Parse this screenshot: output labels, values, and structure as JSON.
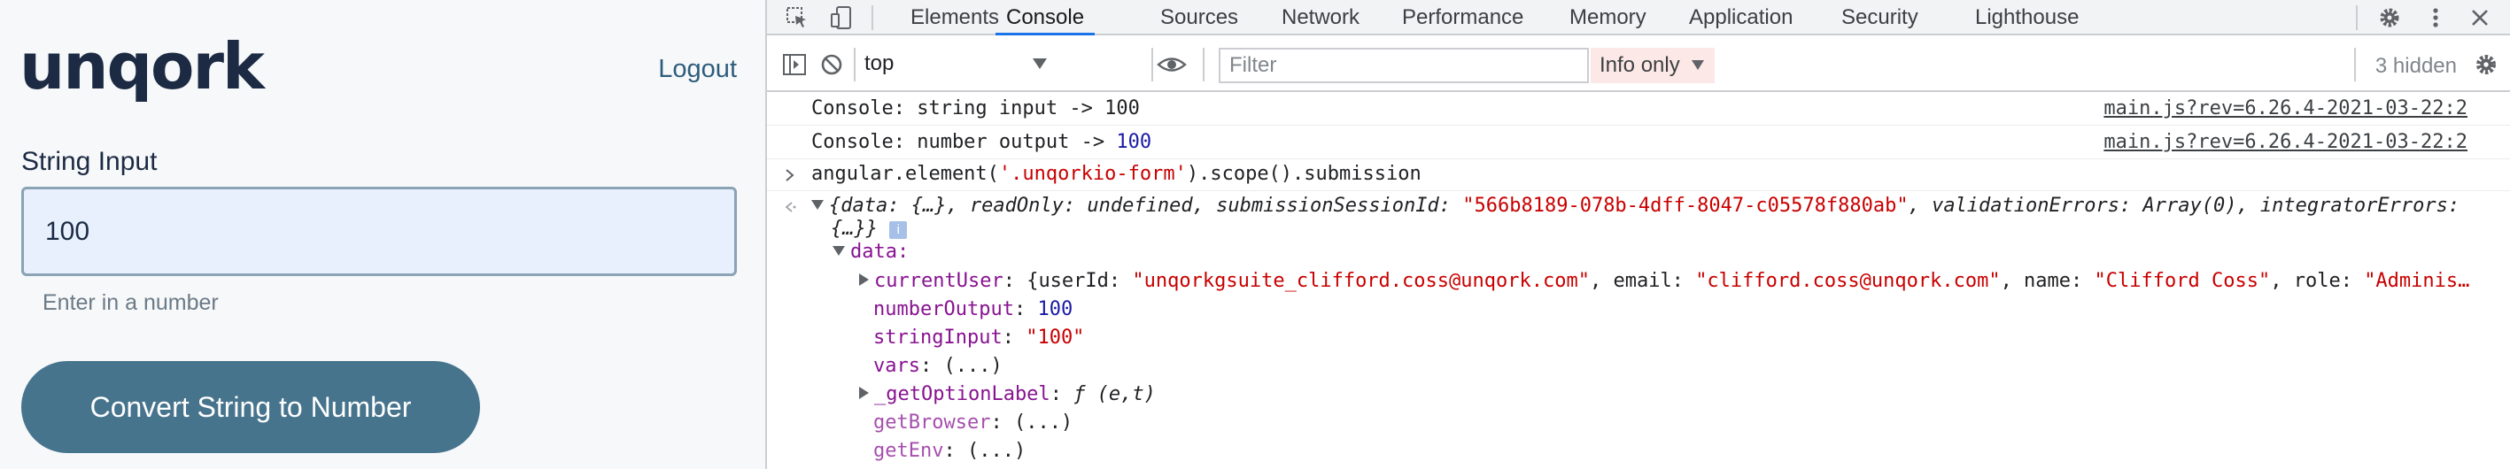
{
  "app": {
    "logo": "unqork",
    "logout_label": "Logout",
    "field_label": "String Input",
    "input_value": "100",
    "hint": "Enter in a number",
    "button_label": "Convert String to Number"
  },
  "devtools": {
    "tabs": [
      "Elements",
      "Console",
      "Sources",
      "Network",
      "Performance",
      "Memory",
      "Application",
      "Security",
      "Lighthouse"
    ],
    "active_tab": "Console",
    "context": "top",
    "filter_placeholder": "Filter",
    "levels_label": "Info only",
    "hidden_count": "3 hidden"
  },
  "console": {
    "log1": {
      "prefix": "Console: string input -> ",
      "value": "100",
      "source": "main.js?rev=6.26.4-2021-03-22:2"
    },
    "log2": {
      "prefix": "Console: number output -> ",
      "value": "100",
      "source": "main.js?rev=6.26.4-2021-03-22:2"
    },
    "command": {
      "head": "angular.element(",
      "arg": "'.unqorkio-form'",
      "tail": ").scope().submission"
    },
    "result": {
      "p1": "{data: {…}, readOnly: undefined, submissionSessionId: ",
      "session_id": "\"566b8189-078b-4dff-8047-c05578f880ab\"",
      "p2": ", validationErrors: Array(0), integratorErrors:",
      "line2": "{…}}",
      "data_key": "data:",
      "current_user": {
        "key": "currentUser",
        "open": ": {userId: ",
        "user_id": "\"unqorkgsuite_clifford.coss@unqork.com\"",
        "email_key": ", email: ",
        "email": "\"clifford.coss@unqork.com\"",
        "name_key": ", name: ",
        "name": "\"Clifford Coss\"",
        "role_key": ", role: ",
        "role": "\"Adminis…"
      },
      "number_output": {
        "key": "numberOutput",
        "value": "100"
      },
      "string_input": {
        "key": "stringInput",
        "value": "\"100\""
      },
      "vars": {
        "key": "vars",
        "value": "(...)"
      },
      "get_option_label": {
        "key": "_getOptionLabel",
        "value": "ƒ (e,t)"
      },
      "get_browser": {
        "key": "getBrowser",
        "value": "(...)"
      },
      "get_env": {
        "key": "getEnv",
        "value": "(...)"
      }
    }
  },
  "colors": {
    "brand_dark": "#1c2b43",
    "button": "#47748d",
    "input_bg": "#e8f0fe",
    "devtools_accent": "#1a73e8"
  }
}
